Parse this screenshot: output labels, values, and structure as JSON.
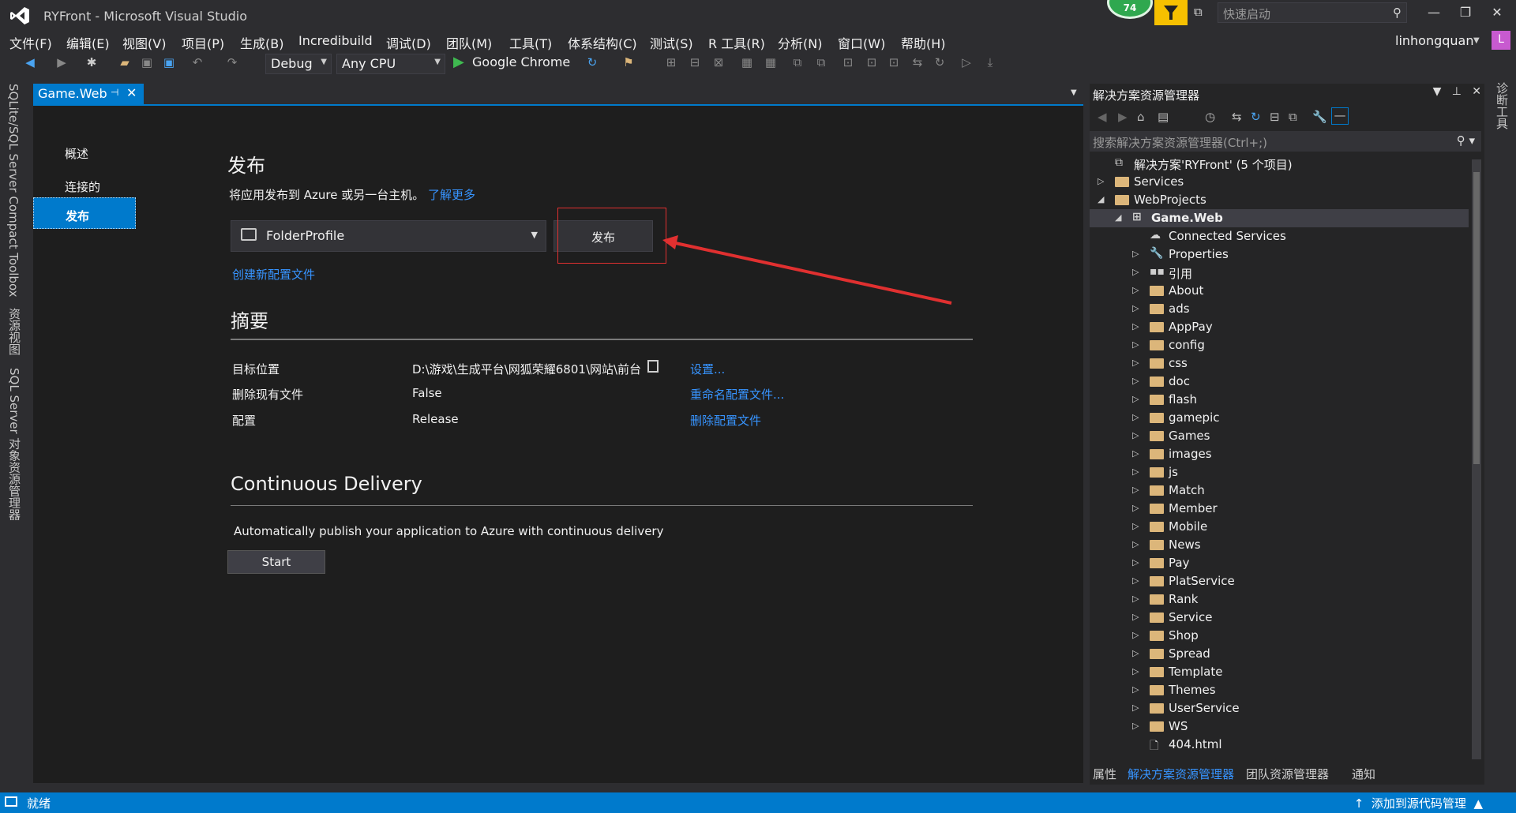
{
  "window": {
    "title": "RYFront - Microsoft Visual Studio",
    "notification_count": "74",
    "quick_launch_placeholder": "快速启动",
    "user": "linhongquan",
    "user_initial": "L"
  },
  "menu": [
    "文件(F)",
    "编辑(E)",
    "视图(V)",
    "项目(P)",
    "生成(B)",
    "Incredibuild",
    "调试(D)",
    "团队(M)",
    "工具(T)",
    "体系结构(C)",
    "测试(S)",
    "R 工具(R)",
    "分析(N)",
    "窗口(W)",
    "帮助(H)"
  ],
  "toolbar": {
    "configuration": "Debug",
    "platform": "Any CPU",
    "run_target": "Google Chrome"
  },
  "left_tool_tabs": [
    "SQLite/SQL Server Compact Toolbox",
    "资源视图",
    "SQL Server 对象资源管理器"
  ],
  "right_tool_tabs": [
    "诊断工具"
  ],
  "document": {
    "tab_label": "Game.Web",
    "nav": [
      "概述",
      "连接的服务",
      "发布"
    ],
    "publish": {
      "heading": "发布",
      "description": "将应用发布到 Azure 或另一台主机。",
      "learn_more": "了解更多",
      "profile": "FolderProfile",
      "publish_button": "发布",
      "create_profile": "创建新配置文件"
    },
    "summary": {
      "heading": "摘要",
      "rows": [
        {
          "label": "目标位置",
          "value": "D:\\游戏\\生成平台\\网狐荣耀6801\\网站\\前台",
          "action": "设置..."
        },
        {
          "label": "删除现有文件",
          "value": "False",
          "action": "重命名配置文件..."
        },
        {
          "label": "配置",
          "value": "Release",
          "action": "删除配置文件"
        }
      ]
    },
    "cd": {
      "heading": "Continuous Delivery",
      "description": "Automatically publish your application to Azure with continuous delivery",
      "start_button": "Start"
    }
  },
  "solution_explorer": {
    "title": "解决方案资源管理器",
    "search_placeholder": "搜索解决方案资源管理器(Ctrl+;)",
    "tree": [
      {
        "label": "解决方案'RYFront' (5 个项目)",
        "level": 0,
        "kind": "solution",
        "expander": ""
      },
      {
        "label": "Services",
        "level": 0,
        "kind": "folder",
        "expander": "▷"
      },
      {
        "label": "WebProjects",
        "level": 0,
        "kind": "folder-open",
        "expander": "◢"
      },
      {
        "label": "Game.Web",
        "level": 1,
        "kind": "project",
        "expander": "◢",
        "selected": true
      },
      {
        "label": "Connected Services",
        "level": 2,
        "kind": "connected",
        "expander": ""
      },
      {
        "label": "Properties",
        "level": 2,
        "kind": "wrench",
        "expander": "▷"
      },
      {
        "label": "引用",
        "level": 2,
        "kind": "reference",
        "expander": "▷"
      },
      {
        "label": "About",
        "level": 2,
        "kind": "folder",
        "expander": "▷"
      },
      {
        "label": "ads",
        "level": 2,
        "kind": "folder",
        "expander": "▷"
      },
      {
        "label": "AppPay",
        "level": 2,
        "kind": "folder",
        "expander": "▷"
      },
      {
        "label": "config",
        "level": 2,
        "kind": "folder",
        "expander": "▷"
      },
      {
        "label": "css",
        "level": 2,
        "kind": "folder",
        "expander": "▷"
      },
      {
        "label": "doc",
        "level": 2,
        "kind": "folder",
        "expander": "▷"
      },
      {
        "label": "flash",
        "level": 2,
        "kind": "folder",
        "expander": "▷"
      },
      {
        "label": "gamepic",
        "level": 2,
        "kind": "folder",
        "expander": "▷"
      },
      {
        "label": "Games",
        "level": 2,
        "kind": "folder",
        "expander": "▷"
      },
      {
        "label": "images",
        "level": 2,
        "kind": "folder",
        "expander": "▷"
      },
      {
        "label": "js",
        "level": 2,
        "kind": "folder",
        "expander": "▷"
      },
      {
        "label": "Match",
        "level": 2,
        "kind": "folder",
        "expander": "▷"
      },
      {
        "label": "Member",
        "level": 2,
        "kind": "folder",
        "expander": "▷"
      },
      {
        "label": "Mobile",
        "level": 2,
        "kind": "folder",
        "expander": "▷"
      },
      {
        "label": "News",
        "level": 2,
        "kind": "folder",
        "expander": "▷"
      },
      {
        "label": "Pay",
        "level": 2,
        "kind": "folder",
        "expander": "▷"
      },
      {
        "label": "PlatService",
        "level": 2,
        "kind": "folder",
        "expander": "▷"
      },
      {
        "label": "Rank",
        "level": 2,
        "kind": "folder",
        "expander": "▷"
      },
      {
        "label": "Service",
        "level": 2,
        "kind": "folder",
        "expander": "▷"
      },
      {
        "label": "Shop",
        "level": 2,
        "kind": "folder",
        "expander": "▷"
      },
      {
        "label": "Spread",
        "level": 2,
        "kind": "folder",
        "expander": "▷"
      },
      {
        "label": "Template",
        "level": 2,
        "kind": "folder",
        "expander": "▷"
      },
      {
        "label": "Themes",
        "level": 2,
        "kind": "folder",
        "expander": "▷"
      },
      {
        "label": "UserService",
        "level": 2,
        "kind": "folder",
        "expander": "▷"
      },
      {
        "label": "WS",
        "level": 2,
        "kind": "folder",
        "expander": "▷"
      },
      {
        "label": "404.html",
        "level": 2,
        "kind": "file",
        "expander": ""
      }
    ],
    "bottom_tabs": [
      "属性",
      "解决方案资源管理器",
      "团队资源管理器",
      "通知"
    ]
  },
  "status": {
    "left": "就绪",
    "right": "添加到源代码管理"
  },
  "colors": {
    "accent": "#007acc",
    "annotation": "#e03030",
    "folder": "#dcb67a"
  }
}
